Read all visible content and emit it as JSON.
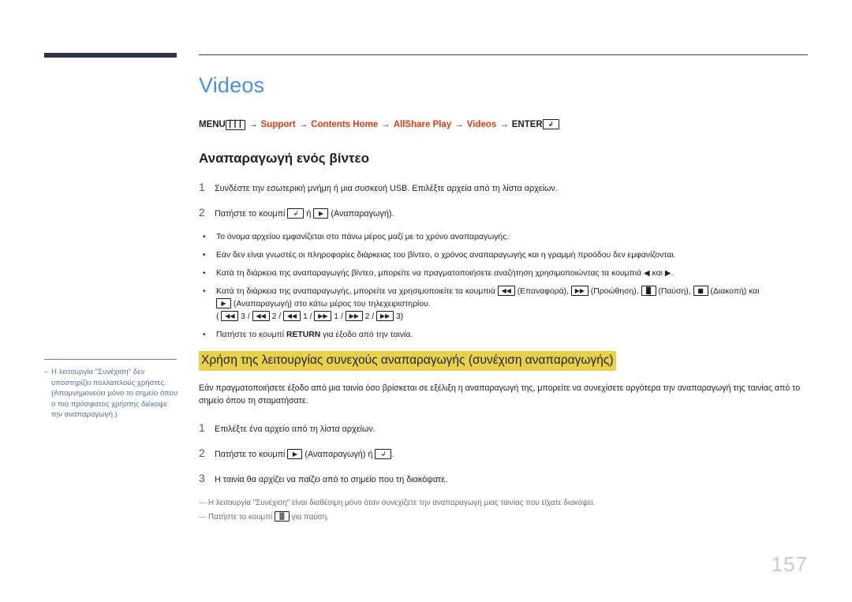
{
  "page": {
    "title": "Videos",
    "number": "157"
  },
  "breadcrumb": {
    "items": [
      {
        "label": "MENU",
        "style": "dark",
        "icon": "menu-icon"
      },
      {
        "label": "Support",
        "style": "red",
        "icon": ""
      },
      {
        "label": "Contents Home",
        "style": "red",
        "icon": ""
      },
      {
        "label": "AllShare Play",
        "style": "red",
        "icon": ""
      },
      {
        "label": "Videos",
        "style": "red",
        "icon": ""
      },
      {
        "label": "ENTER",
        "style": "dark",
        "icon": "enter-icon"
      }
    ],
    "separator": "→"
  },
  "section_play": {
    "heading": "Αναπαραγωγή ενός βίντεο",
    "steps": [
      {
        "num": "1",
        "text": "Συνδέστε την εσωτερική μνήμη ή μια συσκευή USB. Επιλέξτε αρχεία από τη λίστα αρχείων."
      },
      {
        "num": "2",
        "text_before": "Πατήστε το κουμπί ",
        "key1": "enter-icon",
        "text_mid": " ή ",
        "key2": "play-icon",
        "text_after": " (Αναπαραγωγή)."
      }
    ],
    "bullets": {
      "b1": "Το όνομα αρχείου εμφανίζεται στο πάνω μέρος μαζί με το χρόνο αναπαραγωγής.",
      "b2": "Εάν δεν είναι γνωστές οι πληροφορίες διάρκειας του βίντεο, ο χρόνος αναπαραγωγής και η γραμμή προόδου δεν εμφανίζονται.",
      "b3_before": "Κατά τη διάρκεια της αναπαραγωγής βίντεο, μπορείτε να πραγματοποιήσετε αναζήτηση χρησιμοποιώντας τα κουμπιά ",
      "b3_tri_left": "◀",
      "b3_mid": " και ",
      "b3_tri_right": "▶",
      "b3_after": ".",
      "b4_before": "Κατά τη διάρκεια της αναπαραγωγής, μπορείτε να χρησιμοποιείτε τα κουμπιά ",
      "b4_lbl_rew": " (Επαναφορά), ",
      "b4_lbl_ff": " (Προώθηση), ",
      "b4_lbl_pause": " (Παύση), ",
      "b4_lbl_stop": " (Διακοπή) και",
      "b4_line2_lbl": " (Αναπαραγωγή) στο κάτω μέρος του τηλεχειριστηρίου.",
      "b4_seq": [
        {
          "key": "rewind-icon",
          "num": "3"
        },
        {
          "key": "rewind-icon",
          "num": "2"
        },
        {
          "key": "rewind-icon",
          "num": "1"
        },
        {
          "key": "forward-icon",
          "num": "1"
        },
        {
          "key": "forward-icon",
          "num": "2"
        },
        {
          "key": "forward-icon",
          "num": "3"
        }
      ],
      "b5_before": "Πατήστε το κουμπί ",
      "b5_strong": "RETURN",
      "b5_after": " για έξοδο από την ταινία."
    }
  },
  "section_resume": {
    "heading": "Χρήση της λειτουργίας συνεχούς αναπαραγωγής (συνέχιση αναπαραγωγής)",
    "heading_highlight_color": "#e8d24c",
    "paragraph": "Εάν πραγματοποιήσετε έξοδο από μια ταινία όσο βρίσκεται σε εξέλιξη η αναπαραγωγή της, μπορείτε να συνεχίσετε αργότερα την αναπαραγωγή της ταινίας από το σημείο όπου τη σταματήσατε.",
    "steps": [
      {
        "num": "1",
        "text": "Επιλέξτε ένα αρχείο από τη λίστα αρχείων."
      },
      {
        "num": "2",
        "text_before": "Πατήστε το κουμπί ",
        "key1": "play-icon",
        "text_mid": " (Αναπαραγωγή) ή ",
        "key2": "enter-icon",
        "text_after": "."
      },
      {
        "num": "3",
        "text": "Η ταινία θα αρχίζει να παίζει από το σημείο που τη διακόψατε."
      }
    ],
    "footnotes": {
      "f1": "Η λειτουργία \"Συνέχιση\" είναι διαθέσιμη μόνο όταν συνεχίζετε την αναπαραγωγή μιας ταινίας που είχατε διακόψει.",
      "f2_before": "Πατήστε το κουμπί ",
      "f2_key": "pause-icon",
      "f2_after": " για παύση."
    }
  },
  "margin_note": {
    "dash": "–",
    "text": "Η λειτουργία \"Συνέχιση\" δεν υποστηρίζει πολλαπλούς χρήστες. (Απομνημονεύει μόνο το σημείο όπου ο πιο πρόσφατος χρήστης διέκοψε την αναπαραγωγή.)"
  },
  "glyphs": {
    "enter": "↵",
    "play": "▶",
    "pause": "Ⅱ",
    "stop": "■",
    "rewind": "◀◀",
    "forward": "▶▶",
    "menu": "‖‖",
    "bullet": "•",
    "footnote_dash": "—"
  },
  "colors": {
    "title": "#4a90e2",
    "breadcrumb_red": "#e03a12",
    "highlight": "#e8d24c",
    "margin_note": "#5b6e96",
    "page_number": "#c9cacc",
    "rule_navy": "#2e3350"
  }
}
